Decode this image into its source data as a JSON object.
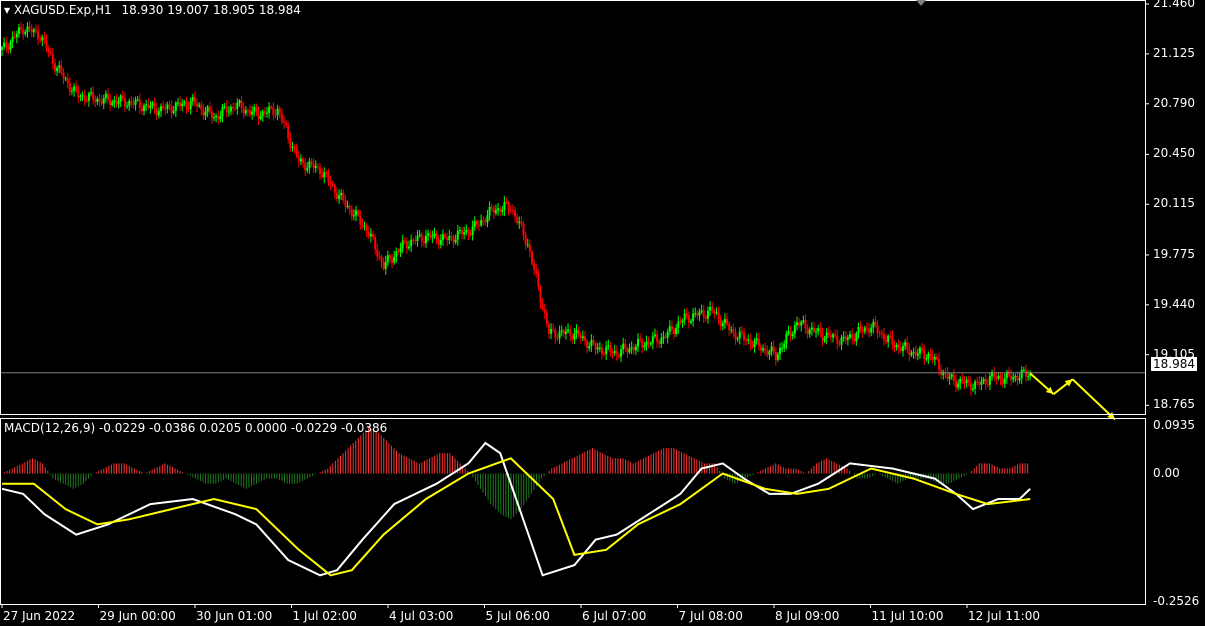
{
  "window": {
    "symbol_header": "XAGUSD.Exp,H1",
    "ohlc": "18.930 19.007 18.905 18.984"
  },
  "indicator": {
    "label": "MACD(12,26,9) -0.0229 -0.0386 0.0205 0.0000 -0.0229 -0.0386"
  },
  "colors": {
    "background": "#000000",
    "bull_candle": "#00ff00",
    "bear_candle": "#ff0000",
    "axis": "#ffffff",
    "macd_line": "#ffffff",
    "signal_line": "#ffff00",
    "hist_pos": "#ff3333",
    "hist_neg": "#1f7a1f",
    "arrow": "#ffff00"
  },
  "chart_data": [
    {
      "type": "candlestick",
      "title": "XAGUSD.Exp,H1",
      "price_axis_ticks": [
        "21.460",
        "21.125",
        "20.790",
        "20.450",
        "20.115",
        "19.775",
        "19.440",
        "19.105",
        "18.765"
      ],
      "ylim": [
        18.68,
        21.46
      ],
      "current_price": "18.984",
      "time_axis_ticks": [
        "27 Jun 2022",
        "29 Jun 00:00",
        "30 Jun 01:00",
        "1 Jul 02:00",
        "4 Jul 03:00",
        "5 Jul 06:00",
        "6 Jul 07:00",
        "7 Jul 08:00",
        "8 Jul 09:00",
        "11 Jul 10:00",
        "12 Jul 11:00"
      ],
      "close_path": [
        [
          0,
          21.15
        ],
        [
          10,
          21.3
        ],
        [
          18,
          21.25
        ],
        [
          25,
          21.05
        ],
        [
          35,
          20.85
        ],
        [
          45,
          20.82
        ],
        [
          60,
          20.8
        ],
        [
          75,
          20.75
        ],
        [
          90,
          20.8
        ],
        [
          100,
          20.7
        ],
        [
          110,
          20.78
        ],
        [
          120,
          20.72
        ],
        [
          130,
          20.75
        ],
        [
          140,
          20.4
        ],
        [
          150,
          20.35
        ],
        [
          160,
          20.15
        ],
        [
          172,
          19.95
        ],
        [
          180,
          19.7
        ],
        [
          190,
          19.85
        ],
        [
          200,
          19.9
        ],
        [
          210,
          19.88
        ],
        [
          222,
          19.95
        ],
        [
          232,
          20.08
        ],
        [
          240,
          20.1
        ],
        [
          248,
          19.85
        ],
        [
          258,
          19.25
        ],
        [
          270,
          19.25
        ],
        [
          280,
          19.15
        ],
        [
          290,
          19.12
        ],
        [
          302,
          19.18
        ],
        [
          312,
          19.22
        ],
        [
          322,
          19.35
        ],
        [
          335,
          19.4
        ],
        [
          345,
          19.25
        ],
        [
          355,
          19.18
        ],
        [
          365,
          19.1
        ],
        [
          375,
          19.32
        ],
        [
          385,
          19.25
        ],
        [
          397,
          19.2
        ],
        [
          410,
          19.3
        ],
        [
          420,
          19.18
        ],
        [
          430,
          19.12
        ],
        [
          438,
          19.1
        ],
        [
          446,
          18.95
        ],
        [
          452,
          18.92
        ],
        [
          460,
          18.9
        ],
        [
          466,
          18.95
        ],
        [
          475,
          18.95
        ],
        [
          485,
          18.98
        ]
      ],
      "projection_arrow_path": [
        [
          485,
          18.98
        ],
        [
          496,
          18.84
        ],
        [
          505,
          18.94
        ],
        [
          525,
          18.67
        ]
      ]
    },
    {
      "type": "macd",
      "title": "MACD(12,26,9)",
      "series": [
        {
          "name": "MACD",
          "points": [
            [
              0,
              -0.03
            ],
            [
              10,
              -0.04
            ],
            [
              20,
              -0.08
            ],
            [
              35,
              -0.12
            ],
            [
              50,
              -0.1
            ],
            [
              70,
              -0.06
            ],
            [
              90,
              -0.05
            ],
            [
              110,
              -0.08
            ],
            [
              120,
              -0.1
            ],
            [
              135,
              -0.17
            ],
            [
              150,
              -0.2
            ],
            [
              158,
              -0.19
            ],
            [
              170,
              -0.13
            ],
            [
              185,
              -0.06
            ],
            [
              205,
              -0.02
            ],
            [
              220,
              0.02
            ],
            [
              228,
              0.06
            ],
            [
              235,
              0.04
            ],
            [
              245,
              -0.08
            ],
            [
              255,
              -0.2
            ],
            [
              270,
              -0.18
            ],
            [
              280,
              -0.13
            ],
            [
              290,
              -0.12
            ],
            [
              305,
              -0.08
            ],
            [
              320,
              -0.04
            ],
            [
              330,
              0.01
            ],
            [
              340,
              0.02
            ],
            [
              350,
              -0.01
            ],
            [
              362,
              -0.04
            ],
            [
              372,
              -0.04
            ],
            [
              385,
              -0.02
            ],
            [
              400,
              0.02
            ],
            [
              420,
              0.01
            ],
            [
              440,
              -0.01
            ],
            [
              450,
              -0.04
            ],
            [
              458,
              -0.07
            ],
            [
              470,
              -0.05
            ],
            [
              480,
              -0.05
            ],
            [
              485,
              -0.03
            ]
          ]
        },
        {
          "name": "Signal",
          "points": [
            [
              0,
              -0.02
            ],
            [
              15,
              -0.02
            ],
            [
              30,
              -0.07
            ],
            [
              45,
              -0.1
            ],
            [
              60,
              -0.09
            ],
            [
              80,
              -0.07
            ],
            [
              100,
              -0.05
            ],
            [
              120,
              -0.07
            ],
            [
              140,
              -0.15
            ],
            [
              155,
              -0.2
            ],
            [
              165,
              -0.19
            ],
            [
              180,
              -0.12
            ],
            [
              200,
              -0.05
            ],
            [
              220,
              0.0
            ],
            [
              240,
              0.03
            ],
            [
              260,
              -0.05
            ],
            [
              270,
              -0.16
            ],
            [
              285,
              -0.15
            ],
            [
              300,
              -0.1
            ],
            [
              320,
              -0.06
            ],
            [
              340,
              0.0
            ],
            [
              360,
              -0.03
            ],
            [
              375,
              -0.04
            ],
            [
              390,
              -0.03
            ],
            [
              410,
              0.01
            ],
            [
              430,
              -0.01
            ],
            [
              450,
              -0.04
            ],
            [
              465,
              -0.06
            ],
            [
              485,
              -0.05
            ]
          ]
        }
      ],
      "histogram": [
        0.0,
        0.01,
        0.02,
        0.03,
        0.02,
        -0.01,
        -0.02,
        -0.03,
        -0.02,
        0.0,
        0.01,
        0.02,
        0.02,
        0.01,
        0.0,
        0.01,
        0.02,
        0.01,
        0.0,
        -0.01,
        -0.02,
        -0.02,
        -0.01,
        -0.02,
        -0.03,
        -0.02,
        -0.01,
        -0.01,
        -0.02,
        -0.02,
        -0.01,
        0.0,
        0.01,
        0.03,
        0.05,
        0.07,
        0.09,
        0.08,
        0.06,
        0.04,
        0.03,
        0.02,
        0.03,
        0.04,
        0.04,
        0.02,
        0.0,
        -0.03,
        -0.06,
        -0.08,
        -0.09,
        -0.07,
        -0.04,
        -0.01,
        0.01,
        0.02,
        0.03,
        0.04,
        0.05,
        0.04,
        0.03,
        0.03,
        0.02,
        0.03,
        0.04,
        0.05,
        0.05,
        0.04,
        0.03,
        0.02,
        0.02,
        -0.01,
        -0.02,
        -0.01,
        0.0,
        0.01,
        0.02,
        0.01,
        0.01,
        0.0,
        0.02,
        0.03,
        0.02,
        0.01,
        -0.01,
        -0.01,
        0.0,
        -0.01,
        -0.02,
        -0.01,
        -0.01,
        -0.01,
        -0.02,
        -0.02,
        -0.01,
        0.0,
        0.02,
        0.02,
        0.01,
        0.01,
        0.02
      ],
      "axis_ticks": [
        "0.0935",
        "0.00",
        "-0.2526"
      ],
      "ylim": [
        -0.2526,
        0.0935
      ]
    }
  ]
}
